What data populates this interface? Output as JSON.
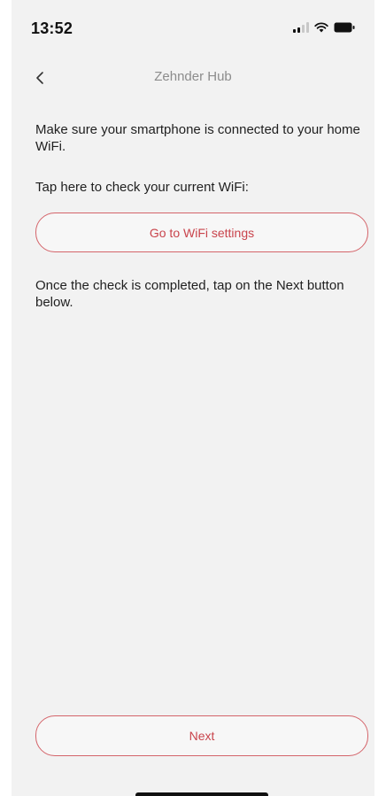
{
  "status_bar": {
    "time": "13:52",
    "icons": [
      "cellular-signal-icon",
      "wifi-icon",
      "battery-icon"
    ]
  },
  "nav": {
    "title": "Zehnder Hub",
    "back_icon": "chevron-left-icon"
  },
  "content": {
    "intro": "Make sure your smartphone is connected to your home WiFi.",
    "tap_prompt": "Tap here to check your current WiFi:",
    "wifi_button_label": "Go to WiFi settings",
    "after_check": "Once the check is completed, tap on the Next button below."
  },
  "footer": {
    "next_label": "Next"
  },
  "colors": {
    "accent": "#c9444c",
    "accent_border": "#d4646a",
    "background": "#f2f2f2",
    "title_gray": "#8c8c8c"
  }
}
